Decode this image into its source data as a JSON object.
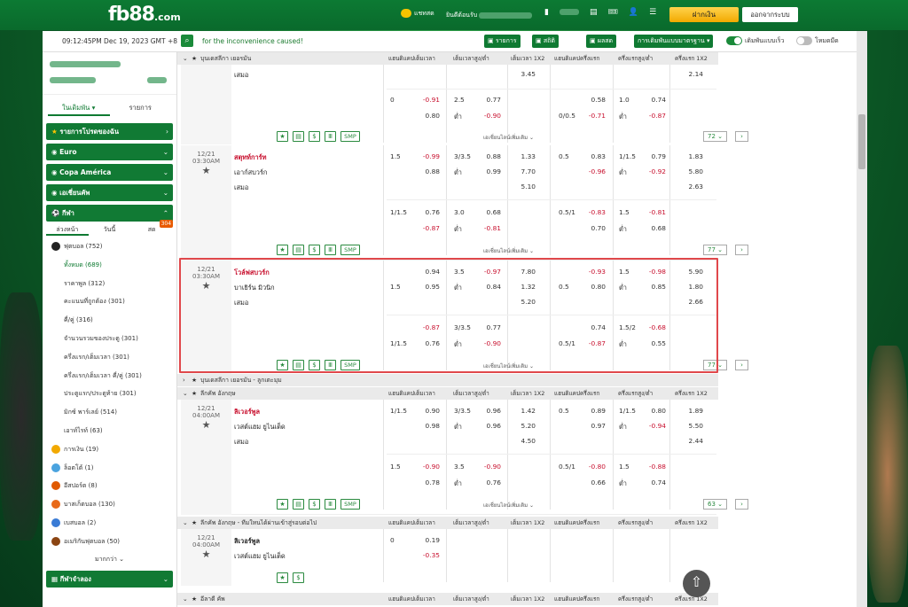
{
  "header": {
    "logo_main": "fb88",
    "logo_suffix": ".com",
    "chat_label": "แชทสด",
    "welcome_label": "ยินดีต้อนรับ",
    "icons": [
      "card-icon",
      "stats-icon",
      "ticket-icon",
      "user-icon",
      "list-icon"
    ],
    "deposit_label": "ฝากเงิน",
    "logout_label": "ออกจากระบบ"
  },
  "subbar": {
    "datetime": "09:12:45PM Dec 19, 2023 GMT +8",
    "ticker": "for the inconvenience caused!",
    "btn_results": "รายการ",
    "btn_stats": "สถิติ",
    "btn_live": "ผลสด",
    "btn_market": "การเดิมพันแบบมาตรฐาน",
    "toggle1_label": "เดิมพันแบบเร็ว",
    "toggle2_label": "โหมดมืด"
  },
  "sidebar": {
    "tab_bets": "ในเดิมพัน",
    "tab_list": "รายการ",
    "sections": {
      "favorites": "รายการโปรดของฉัน",
      "euro": "Euro",
      "copa": "Copa América",
      "asian": "เอเชี่ยนคัพ",
      "sports": "กีฬา",
      "virtual": "กีฬาจำลอง"
    },
    "sport_tabs": [
      "ล่วงหน้า",
      "วันนี้",
      "สด"
    ],
    "live_badge": "304",
    "sports": [
      {
        "label": "ฟุตบอล (752)",
        "sub": false
      },
      {
        "label": "ทั้งหมด (689)",
        "sub": true
      },
      {
        "label": "ราคาพูล (312)",
        "sub": true
      },
      {
        "label": "คะแนนที่ถูกต้อง (301)",
        "sub": true
      },
      {
        "label": "คี่/คู่ (316)",
        "sub": true
      },
      {
        "label": "จำนวนรวมของประตู (301)",
        "sub": true
      },
      {
        "label": "ครึ่งแรก/เต็มเวลา (301)",
        "sub": true
      },
      {
        "label": "ครึ่งแรก/เต็มเวลา คี่/คู่ (301)",
        "sub": true
      },
      {
        "label": "ประตูแรก/ประตูท้าย (301)",
        "sub": true
      },
      {
        "label": "มิกซ์ พาร์เลย์ (514)",
        "sub": true
      },
      {
        "label": "เอาท์ไรท์ (63)",
        "sub": true
      },
      {
        "label": "การเงิน (19)",
        "sub": false
      },
      {
        "label": "ล็อตโต้ (1)",
        "sub": false
      },
      {
        "label": "อีสปอร์ต (8)",
        "sub": false
      },
      {
        "label": "บาสเก็ตบอล (130)",
        "sub": false
      },
      {
        "label": "เบสบอล (2)",
        "sub": false
      },
      {
        "label": "อเมริกันฟุตบอล (50)",
        "sub": false
      }
    ],
    "more_label": "มากกว่า"
  },
  "columns": [
    "แฮนดิแคปเต็มเวลา",
    "เต็มเวลาสูง/ต่ำ",
    "เต็มเวลา 1X2",
    "แฮนดิแคปครึ่งแรก",
    "ครึ่งแรกสูง/ต่ำ",
    "ครึ่งแรก 1X2"
  ],
  "leagues": {
    "l1": "บุนเดสลีกา เยอรมัน",
    "l2": "บุนเดสลีกา เยอรมัน - ลูกเตะมุม",
    "l3": "ลีกคัพ อังกฤษ",
    "l4": "ลีกคัพ อังกฤษ - ทีมใหนได้ผ่านเข้าสู่รอบต่อไป",
    "l5": "อีลาดี คัพ"
  },
  "more_lines": "เอเชี่ยนไลน์เพิ่มเติม",
  "draw": "เสมอ",
  "under": "ต่ำ",
  "smp": "SMP",
  "matches": {
    "m0": {
      "x12_draw": "3.45",
      "h1x2": "2.14",
      "hdp1": "0",
      "o1": "-0.91",
      "ou1": "2.5",
      "ov1": "0.77",
      "o2": "0.80",
      "un1": "-0.90",
      "hh1": "",
      "ho1": "0.58",
      "hou1": "1.0",
      "hov1": "0.74",
      "hh2": "0/0.5",
      "ho2": "-0.71",
      "hun1": "-0.87",
      "count": "72"
    },
    "m1": {
      "date": "12/21",
      "time": "03:30AM",
      "home": "สตุทท์การ์ท",
      "away": "เอาก์สบวร์ก",
      "draw": "เสมอ",
      "a": [
        "1.5",
        "-0.99",
        "3/3.5",
        "0.88",
        "1.33",
        "0.5",
        "0.83",
        "1/1.5",
        "0.79",
        "1.83"
      ],
      "b": [
        "",
        "0.88",
        "ต่ำ",
        "0.99",
        "7.70",
        "",
        "-0.96",
        "ต่ำ",
        "-0.92",
        "5.80"
      ],
      "x12d": "5.10",
      "h12d": "2.63",
      "c": [
        "1/1.5",
        "0.76",
        "3.0",
        "0.68",
        "0.5/1",
        "-0.83",
        "1.5",
        "-0.81"
      ],
      "d": [
        "",
        "-0.87",
        "ต่ำ",
        "-0.81",
        "",
        "0.70",
        "ต่ำ",
        "0.68"
      ],
      "count": "77"
    },
    "m2": {
      "date": "12/21",
      "time": "03:30AM",
      "home": "โวล์ฟสบวร์ก",
      "away": "บาเยิร์น มิวนิก",
      "draw": "เสมอ",
      "a": [
        "",
        "0.94",
        "3.5",
        "-0.97",
        "7.80",
        "",
        "-0.93",
        "1.5",
        "-0.98",
        "5.90"
      ],
      "b": [
        "1.5",
        "0.95",
        "ต่ำ",
        "0.84",
        "1.32",
        "0.5",
        "0.80",
        "ต่ำ",
        "0.85",
        "1.80"
      ],
      "x12d": "5.20",
      "h12d": "2.66",
      "c": [
        "",
        "-0.87",
        "3/3.5",
        "0.77",
        "",
        "0.74",
        "1.5/2",
        "-0.68"
      ],
      "d": [
        "1/1.5",
        "0.76",
        "ต่ำ",
        "-0.90",
        "0.5/1",
        "-0.87",
        "ต่ำ",
        "0.55"
      ],
      "count": "77"
    },
    "m3": {
      "date": "12/21",
      "time": "04:00AM",
      "home": "ลิเวอร์พูล",
      "away": "เวสต์แฮม ยูไนเต็ด",
      "draw": "เสมอ",
      "a": [
        "1/1.5",
        "0.90",
        "3/3.5",
        "0.96",
        "1.42",
        "0.5",
        "0.89",
        "1/1.5",
        "0.80",
        "1.89"
      ],
      "b": [
        "",
        "0.98",
        "ต่ำ",
        "0.96",
        "5.20",
        "",
        "0.97",
        "ต่ำ",
        "-0.94",
        "5.50"
      ],
      "x12d": "4.50",
      "h12d": "2.44",
      "c": [
        "1.5",
        "-0.90",
        "3.5",
        "-0.90",
        "0.5/1",
        "-0.80",
        "1.5",
        "-0.88"
      ],
      "d": [
        "",
        "0.78",
        "ต่ำ",
        "0.76",
        "",
        "0.66",
        "ต่ำ",
        "0.74"
      ],
      "count": "63"
    },
    "m4": {
      "date": "12/21",
      "time": "04:00AM",
      "home": "ลิเวอร์พูล",
      "away": "เวสต์แฮม ยูไนเต็ด",
      "hdp": "0",
      "o1": "0.19",
      "o2": "-0.35"
    }
  },
  "colors": {
    "brand": "#0f7a32",
    "odds_negative": "#c8102e",
    "highlight": "#e0484b"
  }
}
